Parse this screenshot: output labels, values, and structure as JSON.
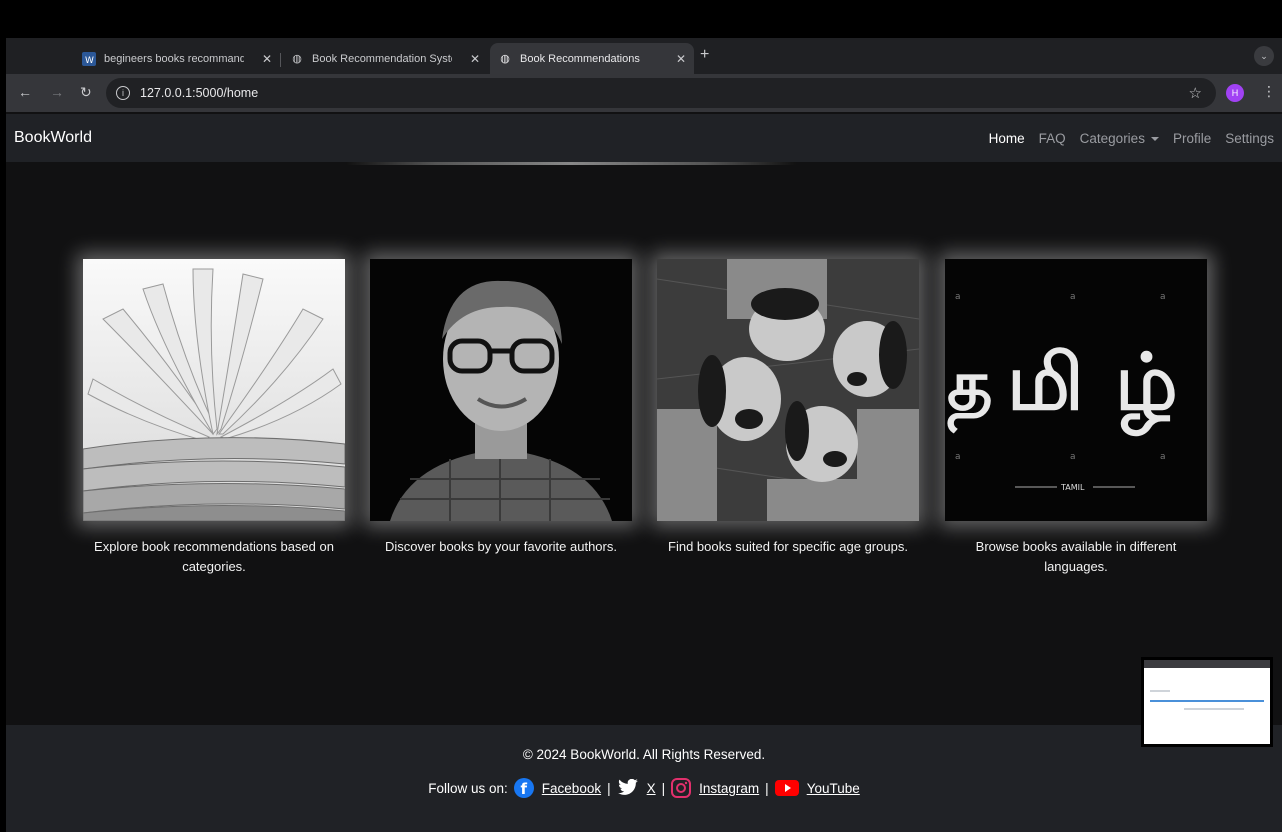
{
  "browser": {
    "tabs": [
      {
        "title": "begineers books recommand",
        "icon": "word-icon"
      },
      {
        "title": "Book Recommendation Syste",
        "icon": "globe-icon"
      },
      {
        "title": "Book Recommendations",
        "icon": "globe-icon",
        "active": true
      }
    ],
    "url": "127.0.0.1:5000/home",
    "profile_initial": "H"
  },
  "navbar": {
    "brand": "BookWorld",
    "links": {
      "home": "Home",
      "faq": "FAQ",
      "categories": "Categories",
      "profile": "Profile",
      "settings": "Settings"
    }
  },
  "cards": [
    {
      "caption": "Explore book recommendations based on categories."
    },
    {
      "caption": "Discover books by your favorite authors."
    },
    {
      "caption": "Find books suited for specific age groups."
    },
    {
      "caption": "Browse books available in different languages."
    }
  ],
  "footer": {
    "copyright": "© 2024 BookWorld. All Rights Reserved.",
    "follow_label": "Follow us on:",
    "facebook": "Facebook",
    "x": "X",
    "instagram": "Instagram",
    "youtube": "YouTube",
    "colors": {
      "facebook": "#1877f2",
      "x": "#1da1f2",
      "instagram": "#e1306c",
      "youtube": "#ff0000"
    }
  }
}
